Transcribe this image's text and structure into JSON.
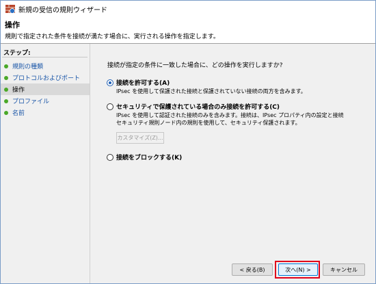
{
  "window": {
    "title": "新規の受信の規則ウィザード",
    "app_icon": "firewall-brick-icon"
  },
  "header": {
    "title": "操作",
    "description": "規則で指定された条件を接続が満たす場合に、実行される操作を指定します。"
  },
  "steps": {
    "label": "ステップ:",
    "items": [
      {
        "label": "規則の種類",
        "current": false
      },
      {
        "label": "プロトコルおよびポート",
        "current": false
      },
      {
        "label": "操作",
        "current": true
      },
      {
        "label": "プロファイル",
        "current": false
      },
      {
        "label": "名前",
        "current": false
      }
    ]
  },
  "main": {
    "question": "接続が指定の条件に一致した場合に、どの操作を実行しますか?",
    "options": [
      {
        "label": "接続を許可する(A)",
        "selected": true,
        "desc": [
          "IPsec を使用して保護された接続と保護されていない接続の両方を含みます。"
        ]
      },
      {
        "label": "セキュリティで保護されている場合のみ接続を許可する(C)",
        "selected": false,
        "desc": [
          "IPsec を使用して認証された接続のみを含みます。接続は、IPsec プロパティ内の設定と接続",
          "セキュリティ規則ノード内の規則を使用して、セキュリティ保護されます。"
        ]
      },
      {
        "label": "接続をブロックする(K)",
        "selected": false,
        "desc": []
      }
    ],
    "customize_label": "カスタマイズ(Z)..."
  },
  "buttons": {
    "back": "< 戻る(B)",
    "next": "次へ(N) >",
    "cancel": "キャンセル"
  },
  "colors": {
    "accent": "#1f5fb5",
    "link": "#1a56a8",
    "step_dot": "#4aa828",
    "highlight": "#e0001a"
  }
}
